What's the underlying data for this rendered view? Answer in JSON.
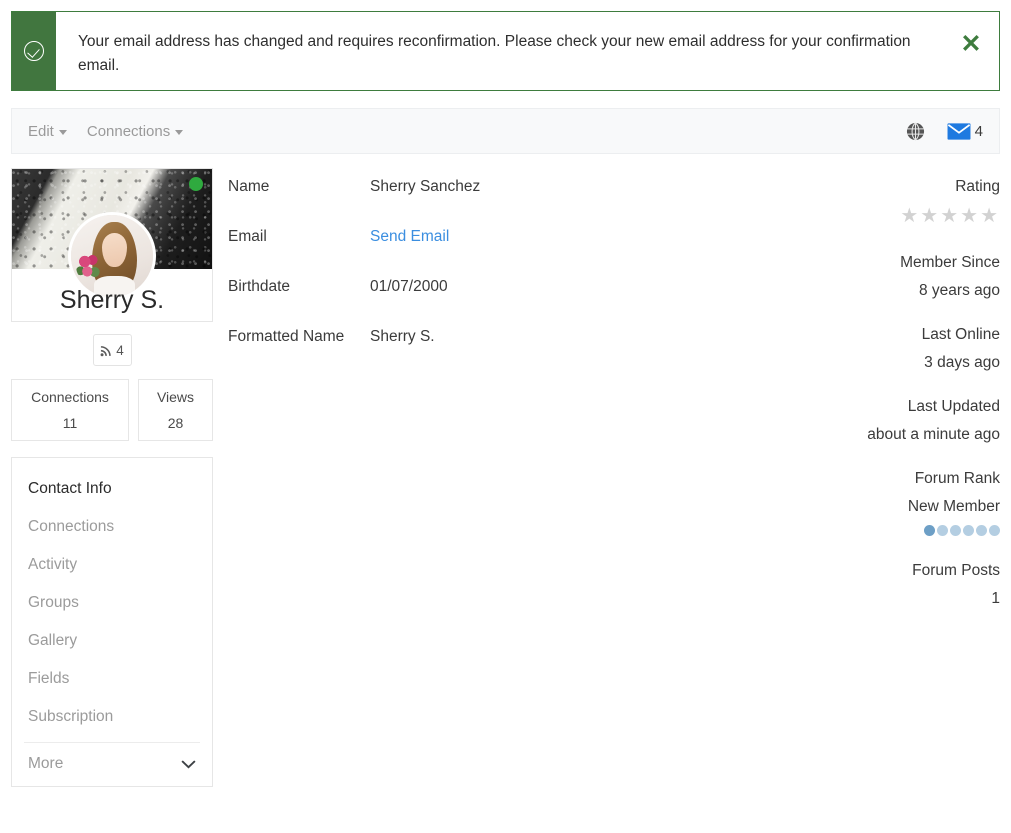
{
  "alert": {
    "icon": "check-circle-icon",
    "message": "Your email address has changed and requires reconfirmation. Please check your new email address for your confirmation email.",
    "close_label": "✕",
    "accent_color": "#41763f"
  },
  "toolbar": {
    "menus": [
      {
        "label": "Edit"
      },
      {
        "label": "Connections"
      }
    ],
    "globe_icon": "globe-icon",
    "mail_icon": "envelope-icon",
    "mail_count": "4",
    "mail_color": "#1f7ae0"
  },
  "profile": {
    "display_name": "Sherry S.",
    "online_status": "online",
    "online_color": "#2faa3f",
    "feed": {
      "icon": "rss-icon",
      "count": "4"
    },
    "stats": [
      {
        "label": "Connections",
        "value": "11"
      },
      {
        "label": "Views",
        "value": "28"
      }
    ]
  },
  "sidebar": {
    "items": [
      {
        "label": "Contact Info",
        "active": true
      },
      {
        "label": "Connections",
        "active": false
      },
      {
        "label": "Activity",
        "active": false
      },
      {
        "label": "Groups",
        "active": false
      },
      {
        "label": "Gallery",
        "active": false
      },
      {
        "label": "Fields",
        "active": false
      },
      {
        "label": "Subscription",
        "active": false
      }
    ],
    "more": {
      "label": "More",
      "icon": "chevron-down-icon"
    }
  },
  "fields": [
    {
      "label": "Name",
      "value": "Sherry Sanchez",
      "is_link": false
    },
    {
      "label": "Email",
      "value": "Send Email",
      "is_link": true
    },
    {
      "label": "Birthdate",
      "value": "01/07/2000",
      "is_link": false
    },
    {
      "label": "Formatted Name",
      "value": "Sherry S.",
      "is_link": false
    }
  ],
  "meta": {
    "rating": {
      "label": "Rating",
      "stars_total": 5,
      "stars_filled": 0,
      "star_glyph": "★"
    },
    "member_since": {
      "label": "Member Since",
      "value": "8 years ago"
    },
    "last_online": {
      "label": "Last Online",
      "value": "3 days ago"
    },
    "last_updated": {
      "label": "Last Updated",
      "value": "about a minute ago"
    },
    "forum_rank": {
      "label": "Forum Rank",
      "value": "New Member",
      "dots_total": 6,
      "dots_filled": 1
    },
    "forum_posts": {
      "label": "Forum Posts",
      "value": "1"
    }
  }
}
